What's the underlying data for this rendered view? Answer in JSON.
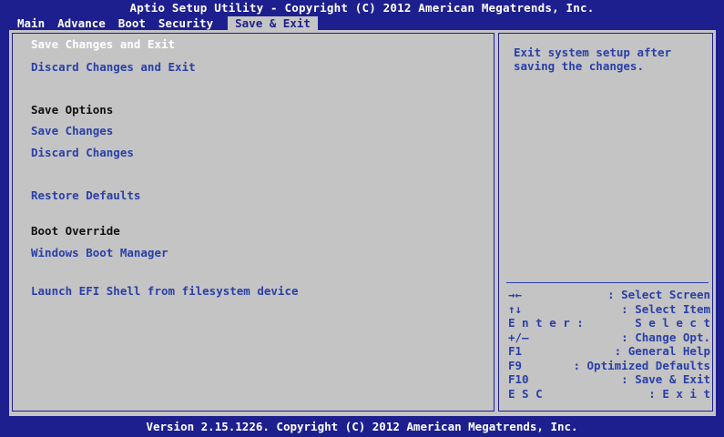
{
  "window": {
    "title": "Aptio Setup Utility - Copyright (C) 2012 American Megatrends, Inc."
  },
  "tabs": [
    {
      "label": "Main"
    },
    {
      "label": "Advance"
    },
    {
      "label": "Boot"
    },
    {
      "label": "Security"
    },
    {
      "label": "Save & Exit"
    }
  ],
  "menu": {
    "items": [
      {
        "label": "Save Changes and Exit"
      },
      {
        "label": "Discard Changes and Exit"
      },
      {
        "label": "Save Options"
      },
      {
        "label": "Save Changes"
      },
      {
        "label": "Discard Changes"
      },
      {
        "label": "Restore Defaults"
      },
      {
        "label": "Boot Override"
      },
      {
        "label": "Windows Boot Manager"
      },
      {
        "label": "Launch EFI Shell from filesystem device"
      }
    ]
  },
  "help": {
    "lines": [
      "Exit system setup after",
      "saving the changes."
    ]
  },
  "keys": [
    {
      "key": "→←",
      "desc": ": Select Screen"
    },
    {
      "key": "↑↓",
      "desc": ": Select Item"
    },
    {
      "key": "E n t e r :",
      "desc": "S e l e c t"
    },
    {
      "key": "+/—",
      "desc": ": Change Opt."
    },
    {
      "key": "F1",
      "desc": ": General Help"
    },
    {
      "key": "F9",
      "desc": ": Optimized Defaults"
    },
    {
      "key": "F10",
      "desc": ": Save  &  Exit"
    },
    {
      "key": "E S C",
      "desc": ":    E x i t"
    }
  ],
  "footer": {
    "text": "Version 2.15.1226. Copyright (C) 2012 American Megatrends, Inc."
  },
  "colors": {
    "frame_blue": "#1e1f8e",
    "panel_gray": "#c4c4c4",
    "option_blue": "#2a3fa8",
    "selected_white": "#ffffff",
    "header_black": "#101010"
  }
}
